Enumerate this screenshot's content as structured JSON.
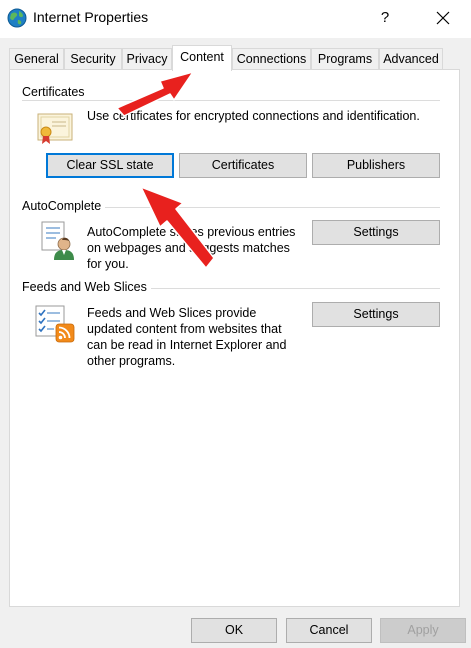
{
  "window": {
    "title": "Internet Properties",
    "help_label": "?"
  },
  "tabs": [
    {
      "label": "General"
    },
    {
      "label": "Security"
    },
    {
      "label": "Privacy"
    },
    {
      "label": "Content",
      "active": true
    },
    {
      "label": "Connections"
    },
    {
      "label": "Programs"
    },
    {
      "label": "Advanced"
    }
  ],
  "certificates": {
    "heading": "Certificates",
    "description": "Use certificates for encrypted connections and identification.",
    "clear_ssl_label": "Clear SSL state",
    "certificates_label": "Certificates",
    "publishers_label": "Publishers"
  },
  "autocomplete": {
    "heading": "AutoComplete",
    "line1": "AutoComplete stores previous entries",
    "line2": "on webpages and suggests matches",
    "line3": "for you.",
    "settings_label": "Settings"
  },
  "feeds": {
    "heading": "Feeds and Web Slices",
    "line1": "Feeds and Web Slices provide",
    "line2": "updated content from websites that",
    "line3": "can be read in Internet Explorer and",
    "line4": "other programs.",
    "settings_label": "Settings"
  },
  "footer": {
    "ok_label": "OK",
    "cancel_label": "Cancel",
    "apply_label": "Apply"
  },
  "colors": {
    "accent": "#0078d7",
    "annotation_arrow": "#e8211e"
  },
  "icons": {
    "window": "globe-icon",
    "certificates": "certificate-icon",
    "autocomplete": "user-document-icon",
    "feeds": "feeds-checklist-icon"
  }
}
